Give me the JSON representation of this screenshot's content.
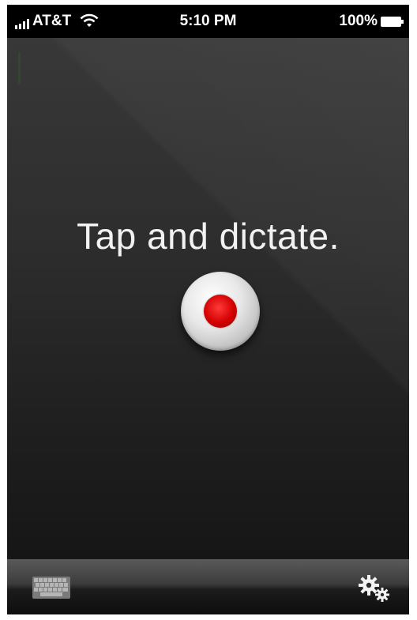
{
  "status_bar": {
    "carrier": "AT&T",
    "time": "5:10 PM",
    "battery": "100%",
    "icons": [
      "signal-bars-icon",
      "wifi-icon",
      "battery-icon"
    ]
  },
  "main": {
    "prompt": "Tap and dictate."
  },
  "record_button": {
    "icon": "record-icon",
    "accent_color": "#d40000"
  },
  "toolbar": {
    "left_icon": "keyboard-icon",
    "right_icon": "settings-gears-icon"
  }
}
